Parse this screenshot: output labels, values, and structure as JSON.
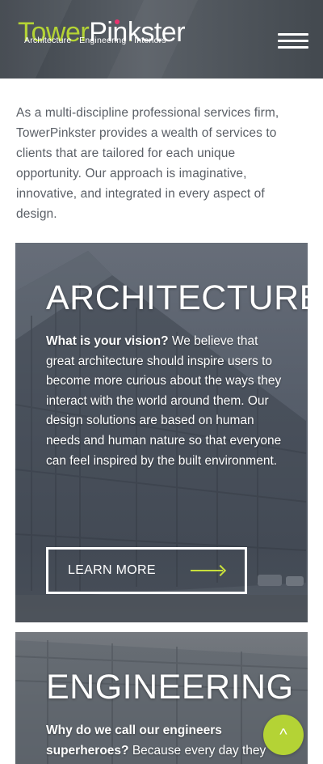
{
  "header": {
    "logo": {
      "part1": "Tower",
      "part2": "Pinkster"
    },
    "tagline": [
      "Architecture",
      "Engineering",
      "Interiors"
    ],
    "tagline_separator": "·",
    "menu_icon": "hamburger-menu-icon",
    "colors": {
      "brand_green": "#b4d335",
      "brand_pink": "#e8336e"
    }
  },
  "intro": {
    "text": "As a multi-discipline professional services firm, TowerPinkster provides a wealth of services to clients that are tailored for each unique opportunity. Our approach is imaginative, innovative, and integrated in every aspect of design."
  },
  "sections": [
    {
      "title": "ARCHITECTURE",
      "lead": "What is your vision?",
      "body": " We believe that great architecture should inspire users to become more curious about the ways they interact with the world around them. Our design solutions are based on human needs and human nature so that everyone can feel inspired by the built environment.",
      "button_label": "LEARN MORE",
      "button_icon": "arrow-right-icon"
    },
    {
      "title": "ENGINEERING",
      "lead": "Why do we call our engineers superheroes?",
      "body": " Because every day they"
    }
  ],
  "back_to_top": {
    "label": "^",
    "icon": "chevron-up-icon"
  }
}
